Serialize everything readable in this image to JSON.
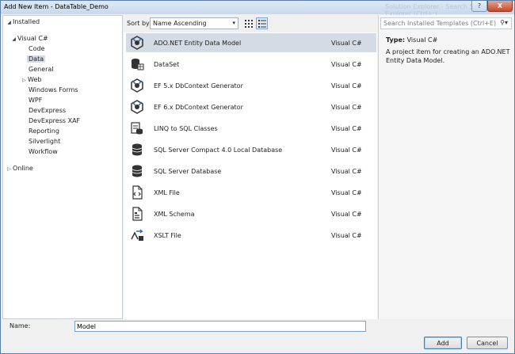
{
  "window": {
    "title": "Add New Item - DataTable_Demo",
    "ghost_title": "Solution Explorer - Search Solution Explorer (Ctrl+;)",
    "help_label": "?",
    "close_label": "X"
  },
  "tree": {
    "installed": "Installed",
    "visual_csharp": "Visual C#",
    "children": [
      "Code",
      "Data",
      "General",
      "Web",
      "Windows Forms",
      "WPF",
      "DevExpress",
      "DevExpress XAF",
      "Reporting",
      "Silverlight",
      "Workflow"
    ],
    "online": "Online"
  },
  "sortbar": {
    "label": "Sort by:",
    "selected": "Name Ascending"
  },
  "items": [
    {
      "name": "ADO.NET Entity Data Model",
      "lang": "Visual C#",
      "icon": "entity-model-icon"
    },
    {
      "name": "DataSet",
      "lang": "Visual C#",
      "icon": "dataset-icon"
    },
    {
      "name": "EF 5.x DbContext Generator",
      "lang": "Visual C#",
      "icon": "dbcontext-generator-icon"
    },
    {
      "name": "EF 6.x DbContext Generator",
      "lang": "Visual C#",
      "icon": "dbcontext-generator-icon"
    },
    {
      "name": "LINQ to SQL Classes",
      "lang": "Visual C#",
      "icon": "linq-to-sql-icon"
    },
    {
      "name": "SQL Server Compact 4.0 Local Database",
      "lang": "Visual C#",
      "icon": "database-icon"
    },
    {
      "name": "SQL Server Database",
      "lang": "Visual C#",
      "icon": "database-icon"
    },
    {
      "name": "XML File",
      "lang": "Visual C#",
      "icon": "xml-file-icon"
    },
    {
      "name": "XML Schema",
      "lang": "Visual C#",
      "icon": "xml-schema-icon"
    },
    {
      "name": "XSLT File",
      "lang": "Visual C#",
      "icon": "xslt-file-icon"
    }
  ],
  "search": {
    "placeholder": "Search Installed Templates (Ctrl+E)"
  },
  "description": {
    "type_label": "Type:",
    "type_value": "Visual C#",
    "text": "A project item for creating an ADO.NET Entity Data Model."
  },
  "footer": {
    "name_label": "Name:",
    "name_value": "Model",
    "add_label": "Add",
    "cancel_label": "Cancel"
  }
}
